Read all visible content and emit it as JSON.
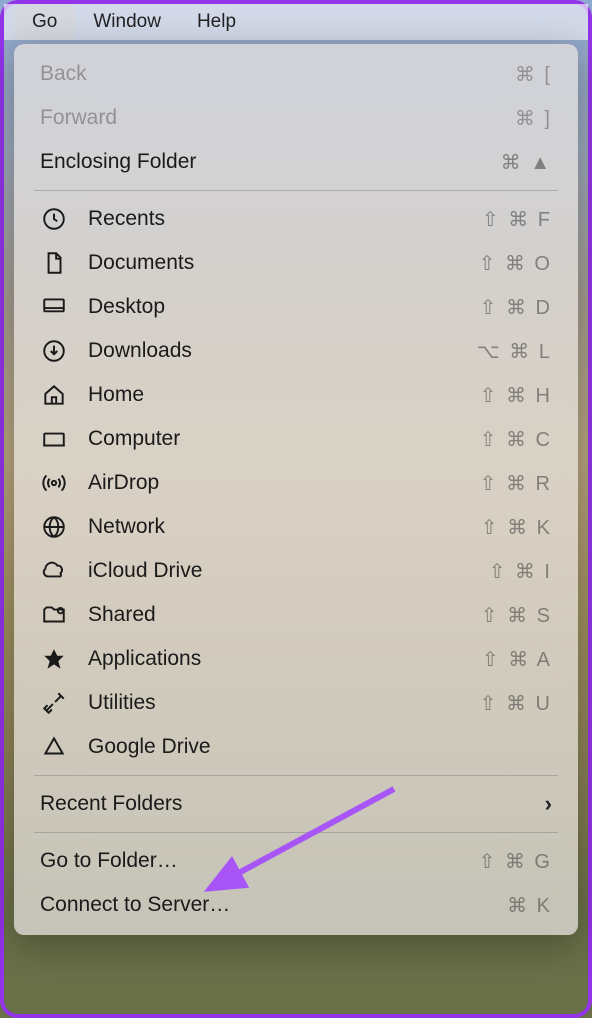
{
  "menubar": {
    "items": [
      {
        "label": "Go",
        "active": true
      },
      {
        "label": "Window",
        "active": false
      },
      {
        "label": "Help",
        "active": false
      }
    ]
  },
  "dropdown": {
    "section1": [
      {
        "label": "Back",
        "shortcut": "⌘ [",
        "disabled": true
      },
      {
        "label": "Forward",
        "shortcut": "⌘ ]",
        "disabled": true
      },
      {
        "label": "Enclosing Folder",
        "shortcut": "⌘ ▲",
        "disabled": false
      }
    ],
    "section2": [
      {
        "label": "Recents",
        "shortcut": "⇧ ⌘ F",
        "icon": "clock"
      },
      {
        "label": "Documents",
        "shortcut": "⇧ ⌘ O",
        "icon": "document"
      },
      {
        "label": "Desktop",
        "shortcut": "⇧ ⌘ D",
        "icon": "desktop"
      },
      {
        "label": "Downloads",
        "shortcut": "⌥ ⌘ L",
        "icon": "download"
      },
      {
        "label": "Home",
        "shortcut": "⇧ ⌘ H",
        "icon": "home"
      },
      {
        "label": "Computer",
        "shortcut": "⇧ ⌘ C",
        "icon": "computer"
      },
      {
        "label": "AirDrop",
        "shortcut": "⇧ ⌘ R",
        "icon": "airdrop"
      },
      {
        "label": "Network",
        "shortcut": "⇧ ⌘ K",
        "icon": "network"
      },
      {
        "label": "iCloud Drive",
        "shortcut": "⇧ ⌘ I",
        "icon": "icloud"
      },
      {
        "label": "Shared",
        "shortcut": "⇧ ⌘ S",
        "icon": "shared"
      },
      {
        "label": "Applications",
        "shortcut": "⇧ ⌘ A",
        "icon": "applications"
      },
      {
        "label": "Utilities",
        "shortcut": "⇧ ⌘ U",
        "icon": "utilities"
      },
      {
        "label": "Google Drive",
        "shortcut": "",
        "icon": "googledrive"
      }
    ],
    "section3": [
      {
        "label": "Recent Folders",
        "shortcut": "",
        "submenu": true
      }
    ],
    "section4": [
      {
        "label": "Go to Folder…",
        "shortcut": "⇧ ⌘ G"
      },
      {
        "label": "Connect to Server…",
        "shortcut": "⌘ K"
      }
    ]
  }
}
